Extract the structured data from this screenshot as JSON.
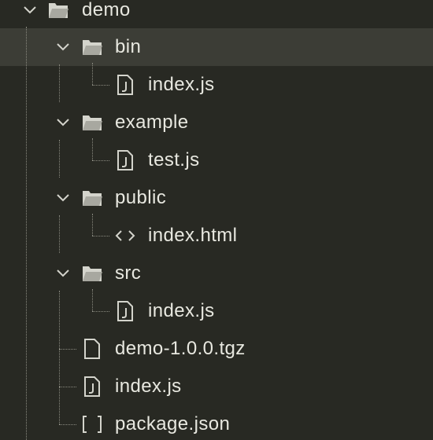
{
  "tree": {
    "root": {
      "name": "demo",
      "type": "folder",
      "icon": "folder-open-icon",
      "expanded": true
    },
    "items": [
      {
        "name": "bin",
        "type": "folder",
        "icon": "folder-open-icon",
        "expanded": true,
        "selected": true
      },
      {
        "name": "index.js",
        "type": "file",
        "icon": "js-file-icon"
      },
      {
        "name": "example",
        "type": "folder",
        "icon": "folder-open-icon",
        "expanded": true
      },
      {
        "name": "test.js",
        "type": "file",
        "icon": "js-file-icon"
      },
      {
        "name": "public",
        "type": "folder",
        "icon": "folder-open-icon",
        "expanded": true
      },
      {
        "name": "index.html",
        "type": "file",
        "icon": "code-icon"
      },
      {
        "name": "src",
        "type": "folder",
        "icon": "folder-open-icon",
        "expanded": true
      },
      {
        "name": "index.js",
        "type": "file",
        "icon": "js-file-icon"
      },
      {
        "name": "demo-1.0.0.tgz",
        "type": "file",
        "icon": "file-icon"
      },
      {
        "name": "index.js",
        "type": "file",
        "icon": "js-file-icon"
      },
      {
        "name": "package.json",
        "type": "file",
        "icon": "brackets-icon"
      }
    ]
  },
  "colors": {
    "background": "#282923",
    "selected_row": "#3c3d36",
    "text": "#e8e8e0",
    "icon": "#d4d4cc",
    "guide": "#8a8a80"
  }
}
